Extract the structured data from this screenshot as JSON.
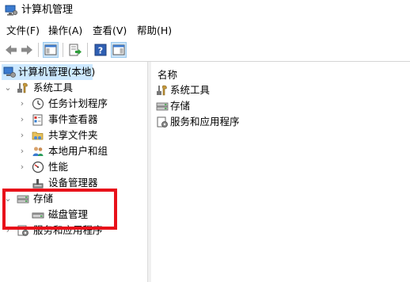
{
  "window": {
    "title": "计算机管理"
  },
  "menu": {
    "items": [
      "文件(F)",
      "操作(A)",
      "查看(V)",
      "帮助(H)"
    ]
  },
  "toolbar": {
    "icons": [
      "back-arrow-icon",
      "forward-arrow-icon",
      "show-hide-console-tree-icon",
      "export-list-icon",
      "help-icon",
      "show-hide-action-pane-icon"
    ]
  },
  "tree": {
    "root": "计算机管理(本地)",
    "system_tools": "系统工具",
    "task_scheduler": "任务计划程序",
    "event_viewer": "事件查看器",
    "shared_folders": "共享文件夹",
    "local_users_groups": "本地用户和组",
    "performance": "性能",
    "device_manager": "设备管理器",
    "storage": "存储",
    "disk_management": "磁盘管理",
    "services_apps": "服务和应用程序"
  },
  "right_pane": {
    "column_header": "名称",
    "items": [
      "系统工具",
      "存储",
      "服务和应用程序"
    ]
  },
  "colors": {
    "highlight": "#e8111a",
    "selection": "#cce8ff"
  }
}
